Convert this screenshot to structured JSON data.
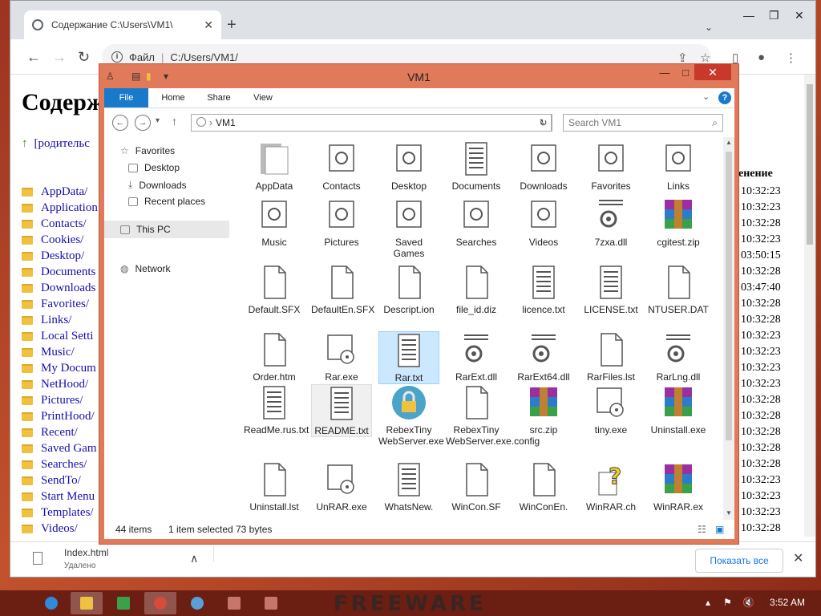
{
  "chrome": {
    "tab_title": "Содержание C:\\Users\\VM1\\",
    "address_label": "Файл",
    "address_path": "C:/Users/VM1/",
    "page_heading": "Содерж",
    "parent_link": "[родительс",
    "column_head": "енение",
    "dirs": [
      "AppData/",
      "Application",
      "Contacts/",
      "Cookies/",
      "Desktop/",
      "Documents",
      "Downloads",
      "Favorites/",
      "Links/",
      "Local Setti",
      "Music/",
      "My Docum",
      "NetHood/",
      "Pictures/",
      "PrintHood/",
      "Recent/",
      "Saved Gam",
      "Searches/",
      "SendTo/",
      "Start Menu",
      "Templates/",
      "Videos/"
    ],
    "times": [
      "10:32:23",
      "10:32:23",
      "10:32:28",
      "10:32:23",
      "03:50:15",
      "10:32:28",
      "03:47:40",
      "10:32:28",
      "10:32:28",
      "10:32:23",
      "10:32:23",
      "10:32:23",
      "10:32:23",
      "10:32:28",
      "10:32:28",
      "10:32:28",
      "10:32:28",
      "10:32:28",
      "10:32:23",
      "10:32:23",
      "10:32:23",
      "10:32:28"
    ],
    "download": {
      "name": "Index.html",
      "status": "Удалено"
    },
    "show_all": "Показать все"
  },
  "explorer": {
    "title": "VM1",
    "ribbon_tabs": [
      "File",
      "Home",
      "Share",
      "View"
    ],
    "path": "VM1",
    "search_placeholder": "Search VM1",
    "nav": {
      "favorites": "Favorites",
      "desktop": "Desktop",
      "downloads": "Downloads",
      "recent": "Recent places",
      "thispc": "This PC",
      "network": "Network"
    },
    "items": [
      [
        "AppData",
        "Contacts",
        "Desktop",
        "Documents",
        "Downloads",
        "Favorites",
        "Links"
      ],
      [
        "Music",
        "Pictures",
        "Saved Games",
        "Searches",
        "Videos",
        "7zxa.dll",
        "cgitest.zip"
      ],
      [
        "Default.SFX",
        "DefaultEn.SFX",
        "Descript.ion",
        "file_id.diz",
        "licence.txt",
        "LICENSE.txt",
        "NTUSER.DAT"
      ],
      [
        "Order.htm",
        "Rar.exe",
        "Rar.txt",
        "RarExt.dll",
        "RarExt64.dll",
        "RarFiles.lst",
        "RarLng.dll"
      ],
      [
        "ReadMe.rus.txt",
        "README.txt",
        "RebexTiny WebServer.exe",
        "RebexTiny WebServer.exe.config",
        "src.zip",
        "tiny.exe",
        "Uninstall.exe"
      ],
      [
        "Uninstall.lst",
        "UnRAR.exe",
        "WhatsNew.",
        "WinCon.SF",
        "WinConEn.",
        "WinRAR.ch",
        "WinRAR.ex"
      ]
    ],
    "status": {
      "count": "44 items",
      "selected": "1 item selected",
      "size": "73 bytes"
    }
  },
  "taskbar": {
    "clock": "3:52 AM",
    "brand": "FREEWARE"
  },
  "colors": {
    "accent": "#1979ca",
    "explorer_frame": "#e07a5a",
    "close": "#c7392b"
  }
}
